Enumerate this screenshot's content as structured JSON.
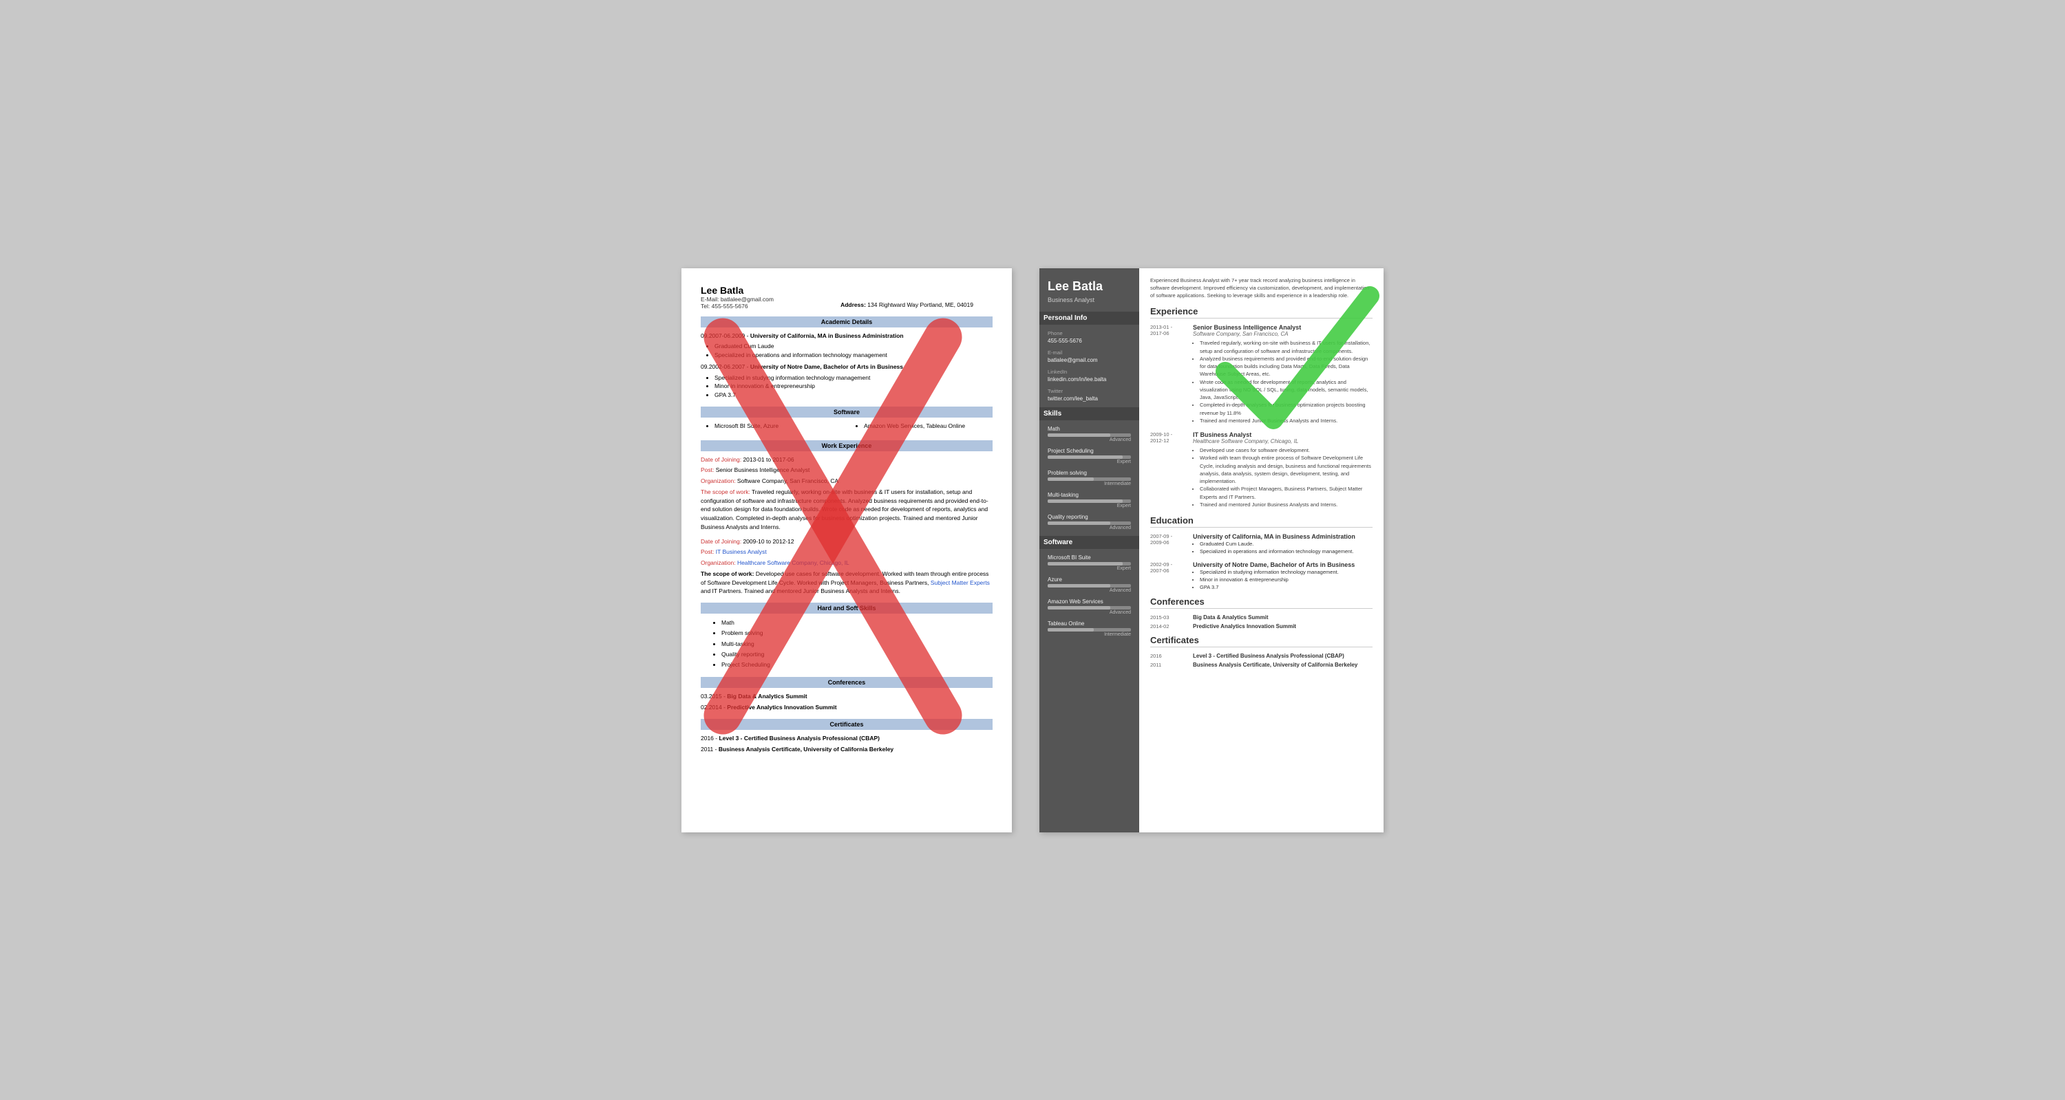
{
  "left_resume": {
    "name": "Lee Batla",
    "email_label": "E-Mail:",
    "email": "batlalee@gmail.com",
    "tel_label": "Tel:",
    "tel": "455-555-5676",
    "address_label": "Address:",
    "address": "134 Rightward Way Portland, ME, 04019",
    "sections": {
      "academic": {
        "title": "Academic Details",
        "entries": [
          {
            "dates": "09.2007-06.2009 -",
            "degree": "University of California, MA in Business Administration",
            "bullets": [
              "Graduated Cum Laude",
              "Specialized in operations and information technology management"
            ]
          },
          {
            "dates": "09.2002-06.2007 -",
            "degree": "University of Notre Dame, Bachelor of Arts in Business",
            "bullets": [
              "Specialized in studying information technology management",
              "Minor in innovation & entrepreneurship",
              "GPA 3.7"
            ]
          }
        ]
      },
      "software": {
        "title": "Software",
        "left_col": [
          "Microsoft BI Suite, Azure"
        ],
        "right_col": [
          "Amazon Web Services,",
          "Tableau Online"
        ]
      },
      "work": {
        "title": "Work Experience",
        "entries": [
          {
            "date_label": "Date of Joining:",
            "dates": "2013-01 to 2017-06",
            "post_label": "Post:",
            "post": "Senior Business Intelligence Analyst",
            "org_label": "Organization:",
            "org": "Software Company, San Francisco, CA",
            "scope_label": "The scope of work:",
            "scope": "Traveled regularly, working on-site with business & IT users for installation, setup and configuration of software and infrastructure components. Analyzed business requirements and provided end-to-end solution design for data foundation builds. Wrote code as needed for development of reports, analytics and visualization. Completed in-depth analyses for business optimization projects. Trained and mentored Junior Business Analysts and Interns."
          },
          {
            "date_label": "Date of Joining:",
            "dates": "2009-10 to 2012-12",
            "post_label": "Post:",
            "post": "IT Business Analyst",
            "org_label": "Organization:",
            "org": "Healthcare Software Company, Chicago, IL",
            "scope_label": "The scope of work:",
            "scope": "Developed use cases for software development. Worked with team through entire process of Software Development Life Cycle. Worked with Project Managers, Business Partners, Subject Matter Experts and IT Partners. Trained and mentored Junior Business Analysts and Interns."
          }
        ]
      },
      "skills": {
        "title": "Hard and Soft Skills",
        "items": [
          "Math",
          "Problem solving",
          "Multi-tasking",
          "Quality reporting",
          "Project Scheduling"
        ]
      },
      "conferences": {
        "title": "Conferences",
        "entries": [
          {
            "date": "03.2015 -",
            "name": "Big Data & Analytics Summit"
          },
          {
            "date": "02.2014 -",
            "name": "Predictive Analytics Innovation Summit"
          }
        ]
      },
      "certificates": {
        "title": "Certificates",
        "entries": [
          {
            "date": "2016 -",
            "name": "Level 3 - Certified Business Analysis Professional (CBAP)"
          },
          {
            "date": "2011 -",
            "name": "Business Analysis Certificate, University of California Berkeley"
          }
        ]
      }
    }
  },
  "right_resume": {
    "name": "Lee Batla",
    "title": "Business Analyst",
    "summary": "Experienced Business Analyst with 7+ year track record analyzing business intelligence in software development. Improved efficiency via customization, development, and implementation of software applications. Seeking to leverage skills and experience in a leadership role.",
    "sidebar": {
      "personal_info_title": "Personal Info",
      "phone_label": "Phone",
      "phone": "455-555-5676",
      "email_label": "E-mail",
      "email": "batlalee@gmail.com",
      "linkedin_label": "LinkedIn",
      "linkedin": "linkedin.com/in/lee.balta",
      "twitter_label": "Twitter",
      "twitter": "twitter.com/lee_balta",
      "skills_title": "Skills",
      "skills": [
        {
          "name": "Math",
          "level": "Advanced",
          "pct": 75
        },
        {
          "name": "Project Scheduling",
          "level": "Expert",
          "pct": 90
        },
        {
          "name": "Problem solving",
          "level": "Intermediate",
          "pct": 55
        },
        {
          "name": "Multi-tasking",
          "level": "Expert",
          "pct": 90
        },
        {
          "name": "Quality reporting",
          "level": "Advanced",
          "pct": 75
        }
      ],
      "software_title": "Software",
      "software": [
        {
          "name": "Microsoft BI Suite",
          "level": "Expert",
          "pct": 90
        },
        {
          "name": "Azure",
          "level": "Advanced",
          "pct": 75
        },
        {
          "name": "Amazon Web Services",
          "level": "Advanced",
          "pct": 75
        },
        {
          "name": "Tableau Online",
          "level": "Intermediate",
          "pct": 55
        }
      ]
    },
    "experience_title": "Experience",
    "experience": [
      {
        "dates": "2013-01 -\n2017-06",
        "title": "Senior Business Intelligence Analyst",
        "org": "Software Company, San Francisco, CA",
        "bullets": [
          "Traveled regularly, working on-site with business & IT users for installation, setup and configuration of software and infrastructure components.",
          "Analyzed business requirements and provided end-to-end solution design for data foundation builds including Data Marts, Data Feeds, Data Warehouse Subject Areas, etc.",
          "Wrote code as needed for development of reports, analytics and visualization using NO SQL / SQL, tuning, data models, semantic models, Java, JavaScript.",
          "Completed in-depth analyses for business optimization projects boosting revenue by 11.8%",
          "Trained and mentored Junior Business Analysts and Interns."
        ]
      },
      {
        "dates": "2009-10 -\n2012-12",
        "title": "IT Business Analyst",
        "org": "Healthcare Software Company, Chicago, IL",
        "bullets": [
          "Developed use cases for software development.",
          "Worked with team through entire process of Software Development Life Cycle, including analysis and design, business and functional requirements analysis, data analysis, system design, development, testing, and implementation.",
          "Collaborated with Project Managers, Business Partners, Subject Matter Experts and IT Partners.",
          "Trained and mentored Junior Business Analysts and Interns."
        ]
      }
    ],
    "education_title": "Education",
    "education": [
      {
        "dates": "2007-09 -\n2009-06",
        "degree": "University of California, MA in Business Administration",
        "bullets": [
          "Graduated Cum Laude.",
          "Specialized in operations and information technology management."
        ]
      },
      {
        "dates": "2002-09 -\n2007-06",
        "degree": "University of Notre Dame, Bachelor of Arts in Business",
        "bullets": [
          "Specialized in studying information technology management.",
          "Minor in innovation & entrepreneurship",
          "GPA 3.7"
        ]
      }
    ],
    "conferences_title": "Conferences",
    "conferences": [
      {
        "date": "2015-03",
        "name": "Big Data & Analytics Summit"
      },
      {
        "date": "2014-02",
        "name": "Predictive Analytics Innovation Summit"
      }
    ],
    "certificates_title": "Certificates",
    "certificates": [
      {
        "date": "2016",
        "name": "Level 3 - Certified Business Analysis Professional (CBAP)"
      },
      {
        "date": "2011",
        "name": "Business Analysis Certificate, University of California Berkeley"
      }
    ]
  }
}
